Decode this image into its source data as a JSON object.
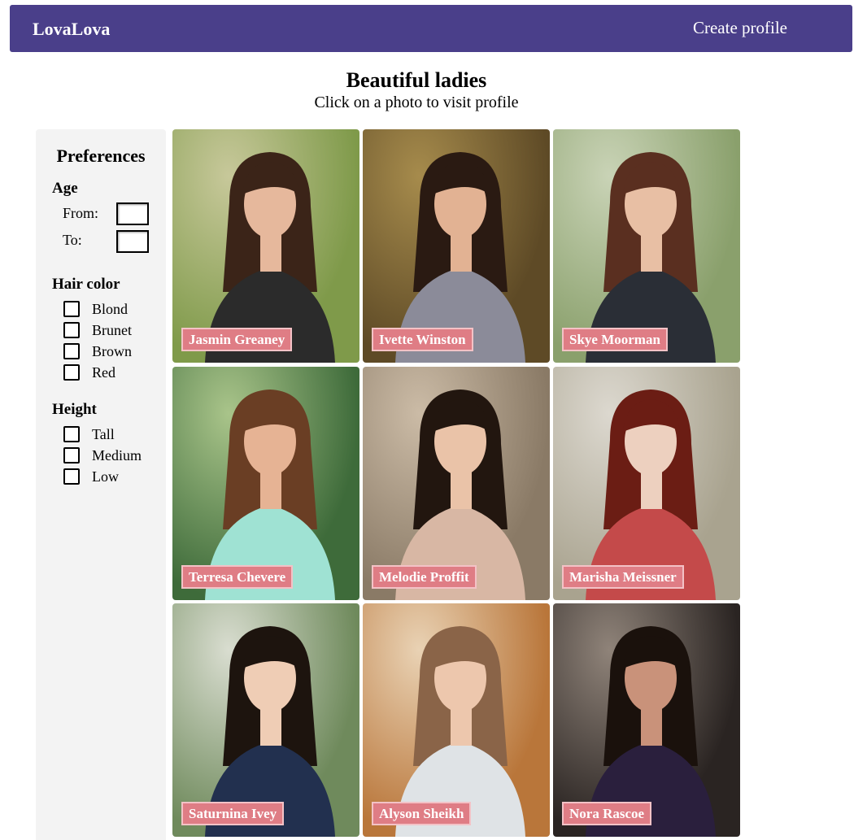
{
  "nav": {
    "brand": "LovaLova",
    "create_profile": "Create profile",
    "bg_color": "#4a3f8a"
  },
  "header": {
    "title": "Beautiful ladies",
    "subtitle": "Click on a photo to visit profile"
  },
  "preferences": {
    "title": "Preferences",
    "age": {
      "label": "Age",
      "from_label": "From:",
      "to_label": "To:",
      "from_value": "",
      "to_value": ""
    },
    "hair_color": {
      "label": "Hair color",
      "options": [
        "Blond",
        "Brunet",
        "Brown",
        "Red"
      ]
    },
    "height": {
      "label": "Height",
      "options": [
        "Tall",
        "Medium",
        "Low"
      ]
    }
  },
  "profiles": [
    {
      "name": "Jasmin Greaney",
      "hair": "brunet",
      "bg": "#7f9a4a",
      "bg2": "#c7c89a",
      "clothes": "#2b2b2b",
      "skin": "#e6b89c",
      "hair_color": "#3b2418"
    },
    {
      "name": "Ivette Winston",
      "hair": "brunet",
      "bg": "#5e4a26",
      "bg2": "#a68b4c",
      "clothes": "#8b8b99",
      "skin": "#e2b293",
      "hair_color": "#2a1a12"
    },
    {
      "name": "Skye Moorman",
      "hair": "brown",
      "bg": "#8aa06c",
      "bg2": "#c9d3b6",
      "clothes": "#2a2e36",
      "skin": "#e8bfa4",
      "hair_color": "#5a2f20"
    },
    {
      "name": "Terresa Chevere",
      "hair": "brown",
      "bg": "#3e6b3a",
      "bg2": "#a9c48a",
      "clothes": "#9fe2d3",
      "skin": "#e6b394",
      "hair_color": "#6a3e24"
    },
    {
      "name": "Melodie Proffit",
      "hair": "brunet",
      "bg": "#8a7a66",
      "bg2": "#cbbba6",
      "clothes": "#d8b7a4",
      "skin": "#eac3a8",
      "hair_color": "#22160f"
    },
    {
      "name": "Marisha Meissner",
      "hair": "red",
      "bg": "#a9a38f",
      "bg2": "#dcd8cf",
      "clothes": "#c44a4a",
      "skin": "#edd0bf",
      "hair_color": "#6b1d14"
    },
    {
      "name": "Saturnina Ivey",
      "hair": "brunet",
      "bg": "#6f8a5c",
      "bg2": "#d9ddd0",
      "clothes": "#22304f",
      "skin": "#efcdb5",
      "hair_color": "#1d140e"
    },
    {
      "name": "Alyson Sheikh",
      "hair": "blond",
      "bg": "#b9763a",
      "bg2": "#e9d2b4",
      "clothes": "#dfe3e6",
      "skin": "#edc7ad",
      "hair_color": "#8a6448"
    },
    {
      "name": "Nora Rascoe",
      "hair": "brunet",
      "bg": "#2a2422",
      "bg2": "#8f8379",
      "clothes": "#2a1f3d",
      "skin": "#c9927a",
      "hair_color": "#1a110c"
    }
  ]
}
